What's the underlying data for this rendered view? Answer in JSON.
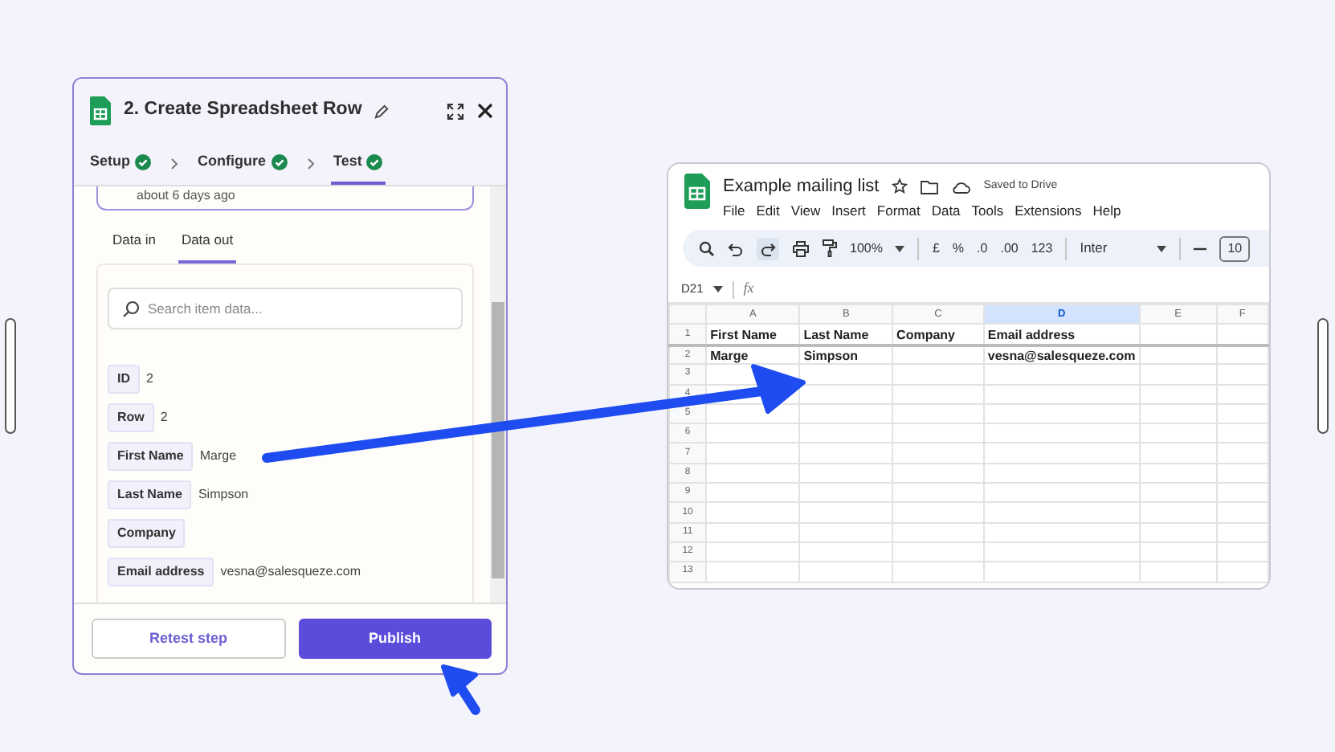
{
  "zap_panel": {
    "title": "2. Create Spreadsheet Row",
    "steps": [
      {
        "label": "Setup",
        "done": true,
        "selected": false
      },
      {
        "label": "Configure",
        "done": true,
        "selected": false
      },
      {
        "label": "Test",
        "done": true,
        "selected": true
      }
    ],
    "run_note": "about 6 days ago",
    "data_tabs": [
      {
        "label": "Data in",
        "selected": false
      },
      {
        "label": "Data out",
        "selected": true
      }
    ],
    "search": {
      "placeholder": "Search item data..."
    },
    "fields": [
      {
        "key": "ID",
        "value": "2"
      },
      {
        "key": "Row",
        "value": "2"
      },
      {
        "key": "First Name",
        "value": "Marge"
      },
      {
        "key": "Last Name",
        "value": "Simpson"
      },
      {
        "key": "Company"
      },
      {
        "key": "Email address",
        "value": "vesna@salesqueze.com"
      }
    ],
    "buttons": [
      {
        "label": "Retest step",
        "kind": "outline"
      },
      {
        "label": "Publish",
        "kind": "primary"
      }
    ]
  },
  "sheet": {
    "title": "Example mailing list",
    "save_status": "Saved to Drive",
    "menu": [
      "File",
      "Edit",
      "View",
      "Insert",
      "Format",
      "Data",
      "Tools",
      "Extensions",
      "Help"
    ],
    "toolbar": {
      "zoom": "100%",
      "currency": "£",
      "percent": "%",
      "decrease_decimals": ".0",
      "increase_decimals": ".00",
      "number_format": "123",
      "font": "Inter",
      "font_size": "10"
    },
    "name_box": "D21",
    "formula_label": "fx",
    "columns": [
      {
        "label": "A",
        "selected": false
      },
      {
        "label": "B",
        "selected": false
      },
      {
        "label": "C",
        "selected": false
      },
      {
        "label": "D",
        "selected": true
      },
      {
        "label": "E",
        "selected": false
      },
      {
        "label": "F",
        "selected": false
      }
    ],
    "rows": [
      {
        "number": "1",
        "cells": [
          "First Name",
          "Last Name",
          "Company",
          "Email address"
        ]
      },
      {
        "number": "2",
        "cells": [
          "Marge",
          "Simpson",
          null,
          "vesna@salesqueze.com"
        ]
      },
      {
        "number": "3"
      },
      {
        "number": "4"
      },
      {
        "number": "5"
      },
      {
        "number": "6"
      },
      {
        "number": "7"
      },
      {
        "number": "8"
      },
      {
        "number": "9"
      },
      {
        "number": "10"
      },
      {
        "number": "11"
      },
      {
        "number": "12"
      },
      {
        "number": "13"
      }
    ]
  }
}
